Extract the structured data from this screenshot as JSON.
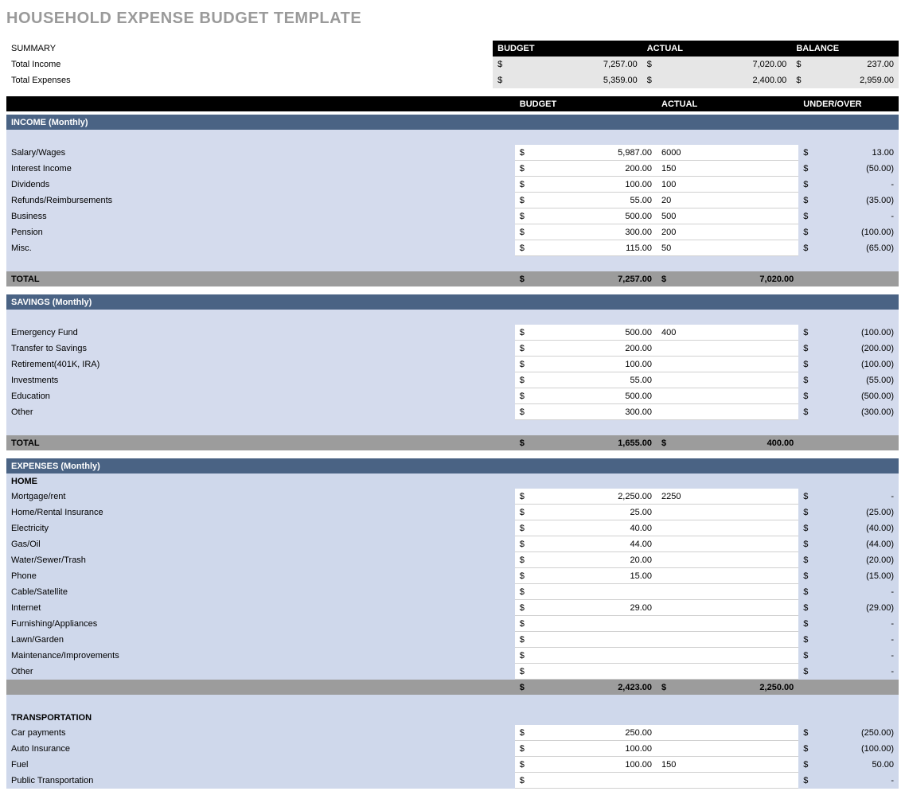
{
  "title": "HOUSEHOLD EXPENSE BUDGET TEMPLATE",
  "summary": {
    "label": "SUMMARY",
    "head": {
      "budget": "BUDGET",
      "actual": "ACTUAL",
      "balance": "BALANCE"
    },
    "rows": [
      {
        "label": "Total Income",
        "budget": "7,257.00",
        "actual": "7,020.00",
        "balance": "237.00"
      },
      {
        "label": "Total Expenses",
        "budget": "5,359.00",
        "actual": "2,400.00",
        "balance": "2,959.00"
      }
    ]
  },
  "main_head": {
    "budget": "BUDGET",
    "actual": "ACTUAL",
    "under_over": "UNDER/OVER"
  },
  "income": {
    "title": "INCOME (Monthly)",
    "rows": [
      {
        "label": "Salary/Wages",
        "budget": "5,987.00",
        "actual": "6000",
        "uo": "13.00"
      },
      {
        "label": "Interest Income",
        "budget": "200.00",
        "actual": "150",
        "uo": "(50.00)"
      },
      {
        "label": "Dividends",
        "budget": "100.00",
        "actual": "100",
        "uo": "-"
      },
      {
        "label": "Refunds/Reimbursements",
        "budget": "55.00",
        "actual": "20",
        "uo": "(35.00)"
      },
      {
        "label": "Business",
        "budget": "500.00",
        "actual": "500",
        "uo": "-"
      },
      {
        "label": "Pension",
        "budget": "300.00",
        "actual": "200",
        "uo": "(100.00)"
      },
      {
        "label": "Misc.",
        "budget": "115.00",
        "actual": "50",
        "uo": "(65.00)"
      }
    ],
    "total": {
      "label": "TOTAL",
      "budget": "7,257.00",
      "actual": "7,020.00"
    }
  },
  "savings": {
    "title": "SAVINGS (Monthly)",
    "rows": [
      {
        "label": "Emergency Fund",
        "budget": "500.00",
        "actual": "400",
        "uo": "(100.00)"
      },
      {
        "label": "Transfer to Savings",
        "budget": "200.00",
        "actual": "",
        "uo": "(200.00)"
      },
      {
        "label": "Retirement(401K, IRA)",
        "budget": "100.00",
        "actual": "",
        "uo": "(100.00)"
      },
      {
        "label": "Investments",
        "budget": "55.00",
        "actual": "",
        "uo": "(55.00)"
      },
      {
        "label": "Education",
        "budget": "500.00",
        "actual": "",
        "uo": "(500.00)"
      },
      {
        "label": "Other",
        "budget": "300.00",
        "actual": "",
        "uo": "(300.00)"
      }
    ],
    "total": {
      "label": "TOTAL",
      "budget": "1,655.00",
      "actual": "400.00"
    }
  },
  "expenses": {
    "title": "EXPENSES (Monthly)",
    "home": {
      "title": "HOME",
      "rows": [
        {
          "label": "Mortgage/rent",
          "budget": "2,250.00",
          "actual": "2250",
          "uo": "-"
        },
        {
          "label": "Home/Rental Insurance",
          "budget": "25.00",
          "actual": "",
          "uo": "(25.00)"
        },
        {
          "label": "Electricity",
          "budget": "40.00",
          "actual": "",
          "uo": "(40.00)"
        },
        {
          "label": "Gas/Oil",
          "budget": "44.00",
          "actual": "",
          "uo": "(44.00)"
        },
        {
          "label": "Water/Sewer/Trash",
          "budget": "20.00",
          "actual": "",
          "uo": "(20.00)"
        },
        {
          "label": "Phone",
          "budget": "15.00",
          "actual": "",
          "uo": "(15.00)"
        },
        {
          "label": "Cable/Satellite",
          "budget": "",
          "actual": "",
          "uo": "-"
        },
        {
          "label": "Internet",
          "budget": "29.00",
          "actual": "",
          "uo": "(29.00)"
        },
        {
          "label": "Furnishing/Appliances",
          "budget": "",
          "actual": "",
          "uo": "-"
        },
        {
          "label": "Lawn/Garden",
          "budget": "",
          "actual": "",
          "uo": "-"
        },
        {
          "label": "Maintenance/Improvements",
          "budget": "",
          "actual": "",
          "uo": "-"
        },
        {
          "label": "Other",
          "budget": "",
          "actual": "",
          "uo": "-"
        }
      ],
      "subtotal": {
        "budget": "2,423.00",
        "actual": "2,250.00"
      }
    },
    "transportation": {
      "title": "TRANSPORTATION",
      "rows": [
        {
          "label": "Car payments",
          "budget": "250.00",
          "actual": "",
          "uo": "(250.00)"
        },
        {
          "label": "Auto Insurance",
          "budget": "100.00",
          "actual": "",
          "uo": "(100.00)"
        },
        {
          "label": "Fuel",
          "budget": "100.00",
          "actual": "150",
          "uo": "50.00"
        },
        {
          "label": "Public Transportation",
          "budget": "",
          "actual": "",
          "uo": "-"
        }
      ]
    }
  }
}
